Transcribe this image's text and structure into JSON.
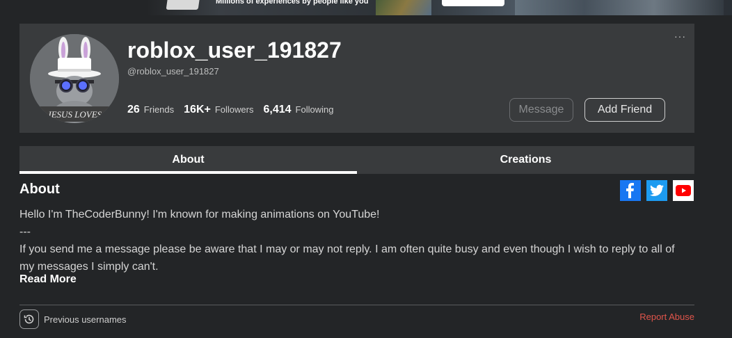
{
  "banner": {
    "tagline": "Millions of experiences by people like you"
  },
  "profile": {
    "username": "roblox_user_191827",
    "handle": "@roblox_user_191827",
    "avatar_caption": "JESUS LOVES",
    "stats": [
      {
        "value": "26",
        "label": "Friends"
      },
      {
        "value": "16K+",
        "label": "Followers"
      },
      {
        "value": "6,414",
        "label": "Following"
      }
    ],
    "more_label": "···",
    "message_label": "Message",
    "add_friend_label": "Add Friend"
  },
  "tabs": [
    {
      "label": "About",
      "active": true
    },
    {
      "label": "Creations",
      "active": false
    }
  ],
  "about": {
    "title": "About",
    "lines": [
      "Hello I'm TheCoderBunny!  I'm known for making animations on YouTube!",
      "---",
      "If you send me a message please be aware that I may or may not reply.  I am often quite busy and even though I wish to reply to all of my messages I simply can't."
    ],
    "read_more": "Read More",
    "social": [
      "facebook-icon",
      "twitter-icon",
      "youtube-icon"
    ]
  },
  "footer": {
    "previous_usernames": "Previous usernames",
    "report_abuse": "Report Abuse"
  },
  "colors": {
    "background": "#232527",
    "card": "#393b3d",
    "report": "#e0554b",
    "facebook": "#1877f2",
    "twitter": "#1d9bf0",
    "youtube": "#ff0000"
  }
}
